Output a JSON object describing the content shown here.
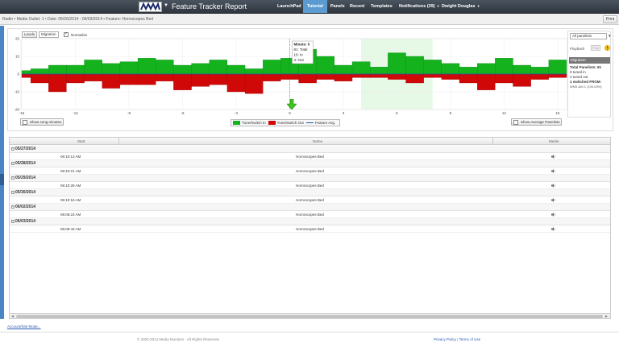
{
  "header": {
    "app_title": "Feature Tracker Report",
    "nav": [
      {
        "label": "LaunchPad",
        "dropdown": false,
        "active": false
      },
      {
        "label": "Tutorial",
        "dropdown": false,
        "active": true
      },
      {
        "label": "Panels",
        "dropdown": false,
        "active": false
      },
      {
        "label": "Recent",
        "dropdown": false,
        "active": false
      },
      {
        "label": "Templates",
        "dropdown": false,
        "active": false
      },
      {
        "label": "Notifications (39)",
        "dropdown": true,
        "active": false
      },
      {
        "label": "Dwight Douglas",
        "dropdown": true,
        "active": false
      }
    ],
    "logo_icon": "media-monitors-logo",
    "active_color": "#5c9bd1"
  },
  "breadcrumb": "Radio • Media Outlet: 1 • Date: 05/26/2014 - 06/03/2014 • Feature: Horroscopes Bed",
  "print_label": "Print",
  "chart_controls": {
    "levels_label": "Levels",
    "migration_label": "Migration",
    "normalize_label": "Normalize",
    "normalize_checked": true,
    "show_song_minutes_label": "Show song minutes",
    "show_average_panelists_label": "Show Average Panelists"
  },
  "tooltip": {
    "title": "Minute: 0",
    "total": "81: Total",
    "in": "10: In",
    "out": "4: Out"
  },
  "chart_data": {
    "type": "bar",
    "title": "",
    "xlabel": "",
    "ylabel": "",
    "xlim": [
      -15,
      15.5
    ],
    "ylim": [
      -20,
      20
    ],
    "x_ticks": [
      -15,
      -12,
      -9,
      -6,
      -3,
      0,
      3,
      6,
      9,
      12,
      15
    ],
    "y_ticks": [
      20,
      10,
      0,
      -10,
      -20
    ],
    "grid": true,
    "highlight_range": [
      4,
      8
    ],
    "x": [
      -16,
      -15,
      -14,
      -13,
      -12,
      -11,
      -10,
      -9,
      -8,
      -7,
      -6,
      -5,
      -4,
      -3,
      -2,
      -1,
      0,
      1,
      2,
      3,
      4,
      5,
      6,
      7,
      8,
      9,
      10,
      11,
      12,
      13,
      14,
      15
    ],
    "series": [
      {
        "name": "Tune/Switch In",
        "color": "#14b31e",
        "values": [
          2,
          2,
          3,
          5,
          5,
          8,
          6,
          7,
          9,
          8,
          5,
          6,
          8,
          5,
          3,
          8,
          9,
          14,
          10,
          5,
          7,
          4,
          12,
          10,
          8,
          6,
          4,
          6,
          9,
          5,
          4,
          8
        ]
      },
      {
        "name": "Tune/Switch Out",
        "color": "#d10808",
        "values": [
          -1,
          -2,
          -5,
          -10,
          -5,
          -4,
          -8,
          -6,
          -6,
          -4,
          -9,
          -7,
          -6,
          -10,
          -11,
          -4,
          -3,
          -5,
          -3,
          -4,
          -2,
          -2,
          -3,
          -5,
          -2,
          -3,
          -5,
          -9,
          -5,
          -7,
          -3,
          -2
        ]
      },
      {
        "name": "Feature Avg."
      }
    ]
  },
  "axis": {
    "y_tick_labels": [
      "20",
      "10",
      "0",
      "-10",
      "-20"
    ],
    "x_tick_labels": [
      "-15",
      "-12",
      "-9",
      "-6",
      "-3",
      "0",
      "3",
      "6",
      "9",
      "12",
      "15"
    ]
  },
  "right_panel": {
    "select_value": "All panelists",
    "playback_label": "Playback",
    "play_label": "Play",
    "migration_title": "Migration",
    "total_panelists": "Total Panelists: 81",
    "tuned_in": "9 tuned in",
    "tuned_out": "4 tuned out",
    "switched_from": "1 switched FROM:",
    "station": "WNS-AM 1 (100.00%)"
  },
  "table": {
    "columns": [
      "Start",
      "Name",
      "Media"
    ],
    "groups": [
      {
        "date": "05/27/2014",
        "rows": [
          {
            "start": "06:10:13 AM",
            "name": "Horroscopes Bed"
          }
        ]
      },
      {
        "date": "05/28/2014",
        "rows": [
          {
            "start": "06:10:21 AM",
            "name": "Horroscopes Bed"
          }
        ]
      },
      {
        "date": "05/29/2014",
        "rows": [
          {
            "start": "06:10:28 AM",
            "name": "Horroscopes Bed"
          }
        ]
      },
      {
        "date": "05/30/2014",
        "rows": [
          {
            "start": "06:10:16 AM",
            "name": "Horroscopes Bed"
          }
        ]
      },
      {
        "date": "06/02/2014",
        "rows": [
          {
            "start": "06:08:23 AM",
            "name": "Horroscopes Bed"
          }
        ]
      },
      {
        "date": "06/03/2014",
        "rows": [
          {
            "start": "06:09:43 AM",
            "name": "Horroscopes Bed"
          }
        ]
      }
    ],
    "media_icon": "speaker-icon"
  },
  "footer": {
    "account_link": "Account/Site Mode...",
    "copyright": "© 2002-2014 Media Monitors - All Rights Reserved.",
    "privacy": "Privacy Policy",
    "terms": "Terms of Use"
  }
}
